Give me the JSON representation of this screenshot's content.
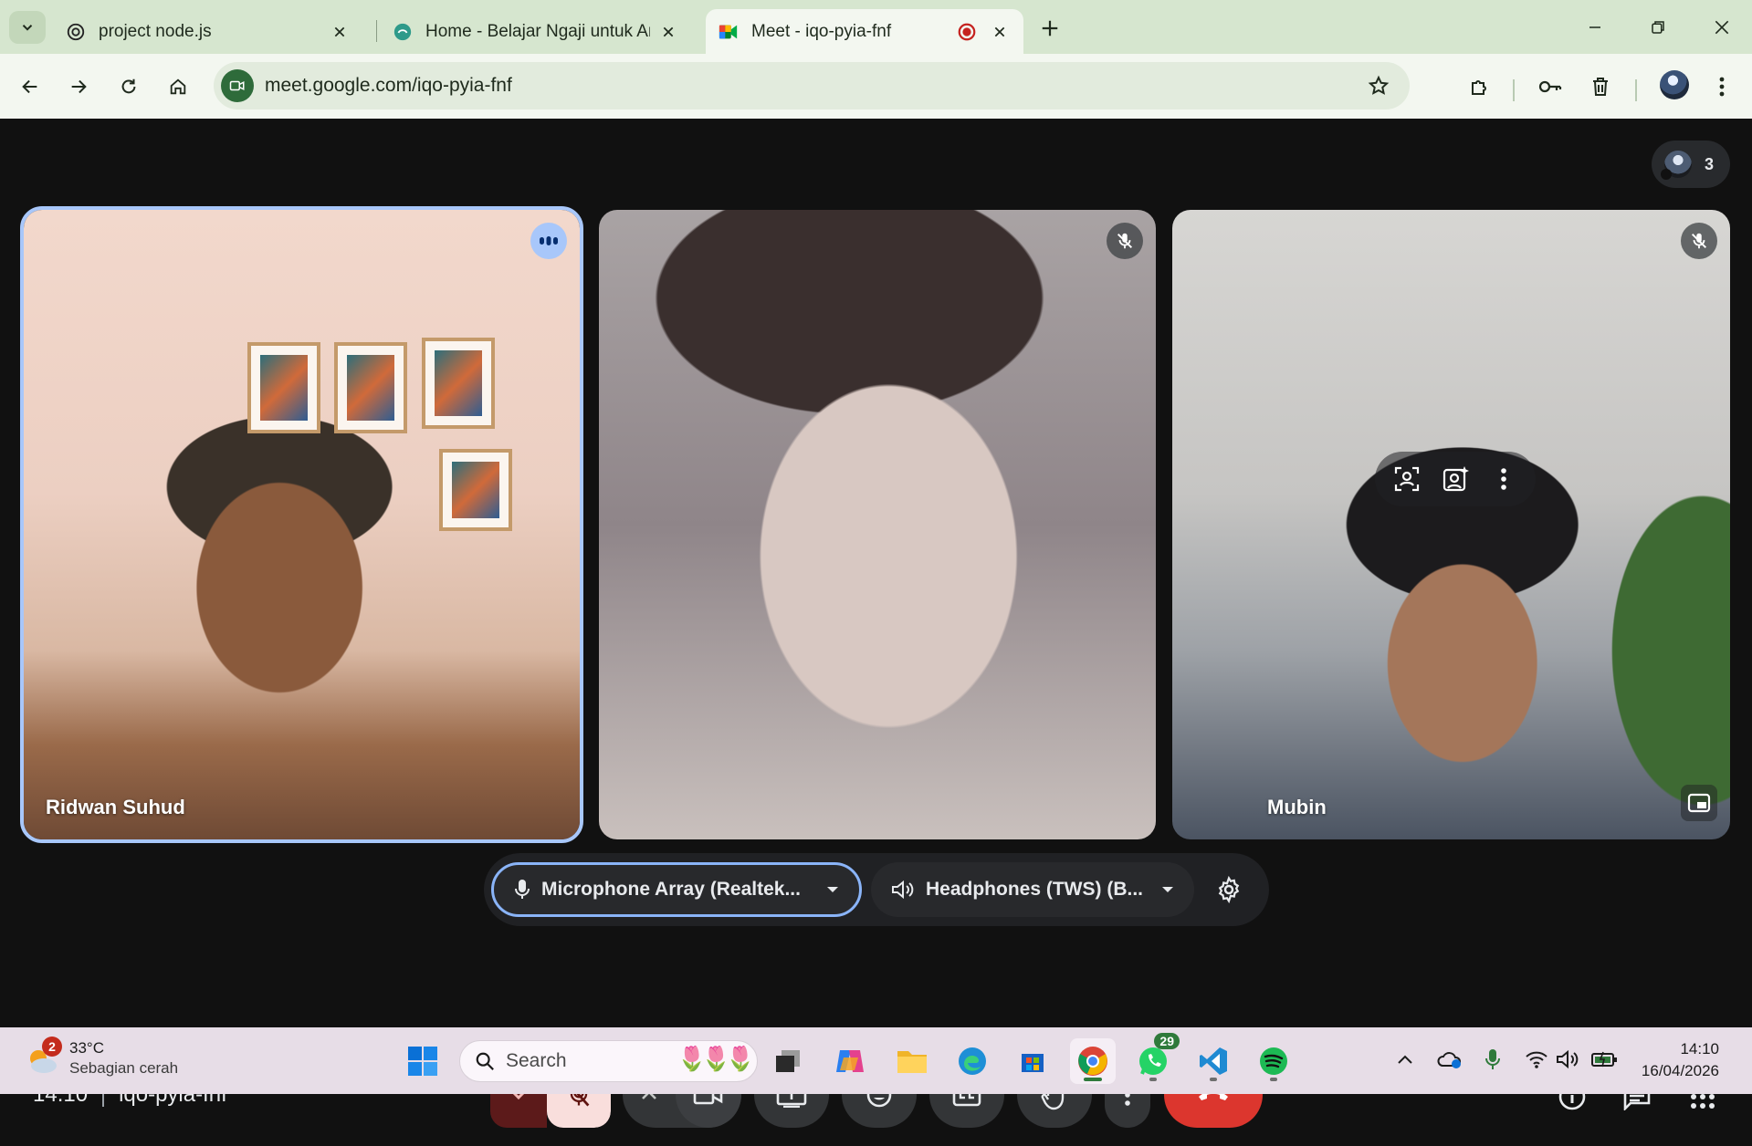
{
  "browser": {
    "tabs": [
      {
        "title": "project node.js",
        "active": false
      },
      {
        "title": "Home - Belajar Ngaji untuk Ana",
        "active": false
      },
      {
        "title": "Meet - iqo-pyia-fnf",
        "active": true,
        "recording": true
      }
    ],
    "url": "meet.google.com/iqo-pyia-fnf"
  },
  "meet": {
    "participant_count": "3",
    "tiles": [
      {
        "name": "Ridwan Suhud",
        "speaking": true
      },
      {
        "name": "",
        "muted": true
      },
      {
        "name": "Mubin",
        "muted": true
      }
    ],
    "device_popup": {
      "microphone": "Microphone Array (Realtek...",
      "speaker": "Headphones (TWS) (B..."
    },
    "bottom_bar": {
      "time": "14.10",
      "meeting_code": "iqo-pyia-fnf"
    },
    "colors": {
      "accent": "#a8c7fa",
      "leave": "#dc362e",
      "mic_off_bg": "#f9dedc"
    }
  },
  "taskbar": {
    "weather": {
      "badge": "2",
      "temp": "33°C",
      "desc": "Sebagian cerah"
    },
    "search_placeholder": "Search",
    "whatsapp_badge": "29",
    "clock": {
      "time": "14:10",
      "date": "16/04/2026"
    }
  }
}
